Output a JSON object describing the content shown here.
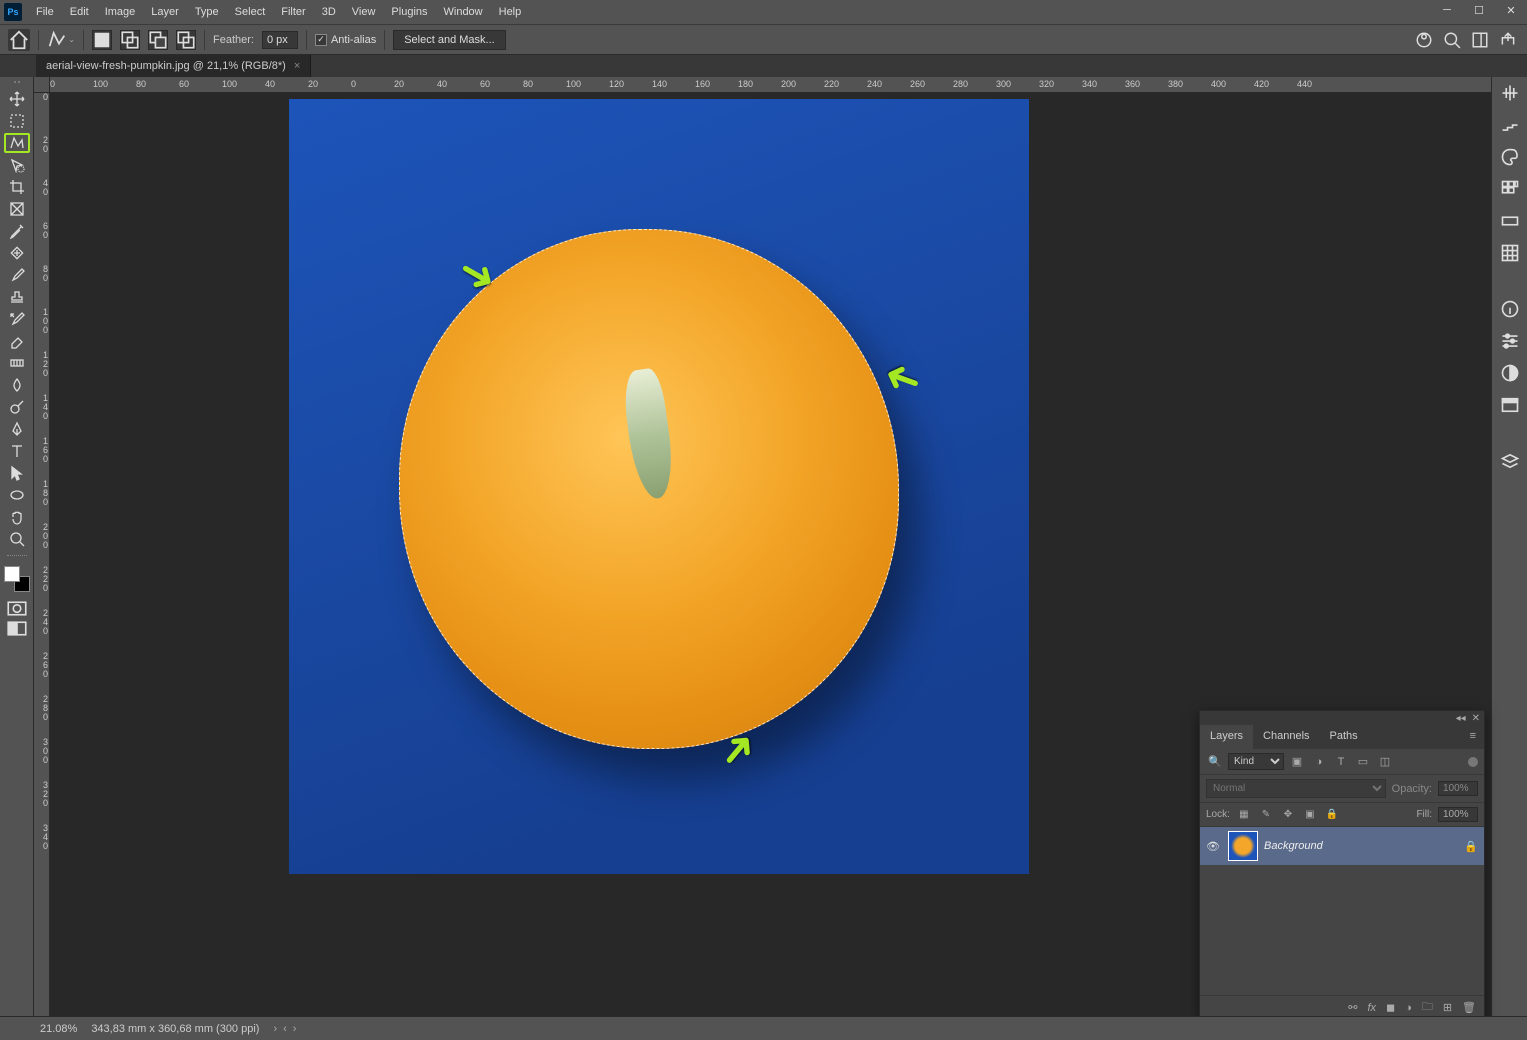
{
  "menubar": {
    "app": "Ps",
    "items": [
      "File",
      "Edit",
      "Image",
      "Layer",
      "Type",
      "Select",
      "Filter",
      "3D",
      "View",
      "Plugins",
      "Window",
      "Help"
    ]
  },
  "options": {
    "feather_label": "Feather:",
    "feather_value": "0 px",
    "antialias_label": "Anti-alias",
    "antialias_checked": true,
    "select_mask": "Select and Mask..."
  },
  "tab": {
    "title": "aerial-view-fresh-pumpkin.jpg @ 21,1% (RGB/8*)"
  },
  "ruler_h": [
    "0",
    "100",
    "80",
    "60",
    "100",
    "40",
    "20",
    "0",
    "20",
    "40",
    "60",
    "80",
    "100",
    "120",
    "140",
    "160",
    "180",
    "200",
    "220",
    "240",
    "260",
    "280",
    "300",
    "320",
    "340",
    "360",
    "380",
    "400",
    "420",
    "440"
  ],
  "ruler_v": [
    "0",
    "2 0",
    "4 0",
    "6 0",
    "8 0",
    "1 0 0",
    "1 2 0",
    "1 4 0",
    "1 6 0",
    "1 8 0",
    "2 0 0",
    "2 2 0",
    "2 4 0",
    "2 6 0",
    "2 8 0",
    "3 0 0",
    "3 2 0",
    "3 4 0"
  ],
  "layers_panel": {
    "tabs": [
      "Layers",
      "Channels",
      "Paths"
    ],
    "filter_kind": "Kind",
    "blend_mode": "Normal",
    "opacity_label": "Opacity:",
    "opacity_value": "100%",
    "lock_label": "Lock:",
    "fill_label": "Fill:",
    "fill_value": "100%",
    "layer_name": "Background"
  },
  "status": {
    "zoom": "21.08%",
    "docinfo": "343,83 mm x 360,68 mm (300 ppi)"
  }
}
